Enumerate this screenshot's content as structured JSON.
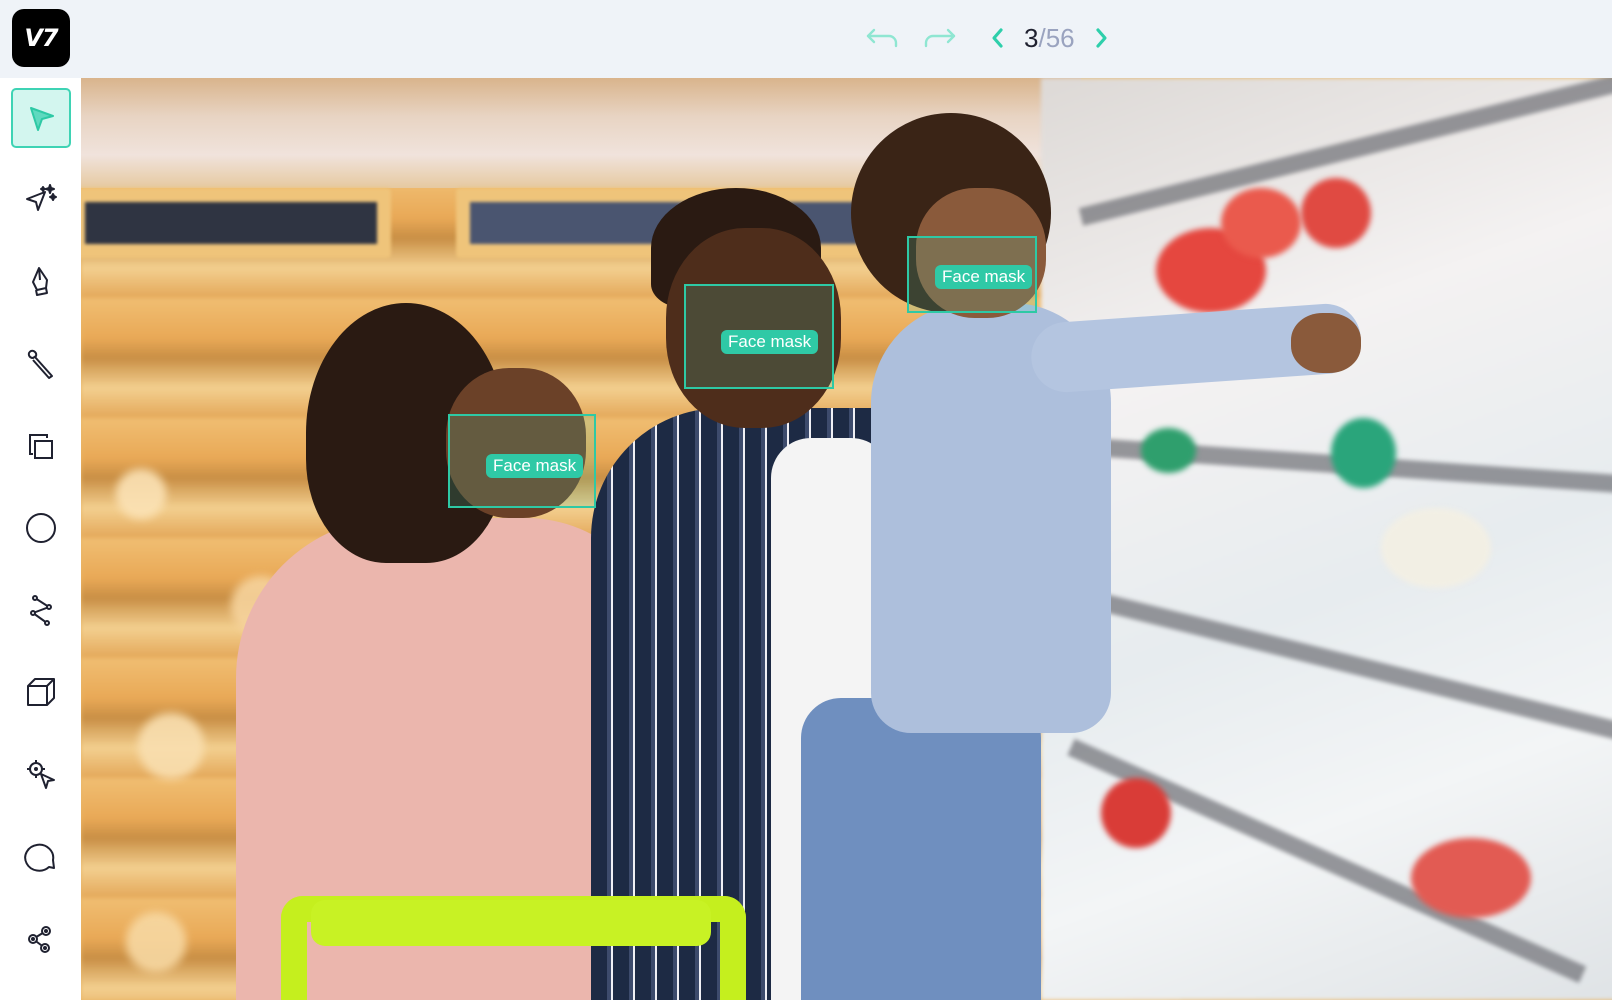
{
  "app": {
    "logo_text": "V7"
  },
  "toolbar": {
    "undo_icon": "undo-icon",
    "redo_icon": "redo-icon",
    "prev_icon": "chevron-left-icon",
    "next_icon": "chevron-right-icon",
    "current_page": "3",
    "separator": "/",
    "total_pages": "56",
    "accent_color": "#2ecfab",
    "disabled_color": "#8fe6d2"
  },
  "sidebar": {
    "tools": [
      {
        "name": "select",
        "icon": "cursor-arrow-icon",
        "active": true
      },
      {
        "name": "auto-annotate",
        "icon": "magic-cursor-sparkles-icon",
        "active": false
      },
      {
        "name": "polygon",
        "icon": "pen-nib-icon",
        "active": false
      },
      {
        "name": "brush",
        "icon": "paintbrush-icon",
        "active": false
      },
      {
        "name": "bounding-box",
        "icon": "overlapping-squares-icon",
        "active": false
      },
      {
        "name": "ellipse",
        "icon": "circle-icon",
        "active": false
      },
      {
        "name": "polyline",
        "icon": "polyline-icon",
        "active": false
      },
      {
        "name": "cuboid",
        "icon": "cube-icon",
        "active": false
      },
      {
        "name": "keypoint",
        "icon": "keypoint-cursor-icon",
        "active": false
      },
      {
        "name": "comment",
        "icon": "speech-bubble-icon",
        "active": false
      },
      {
        "name": "skeleton",
        "icon": "skeleton-nodes-icon",
        "active": false
      }
    ]
  },
  "canvas": {
    "image_description": "Family wearing face masks shopping in a supermarket",
    "annotations": [
      {
        "label": "Face mask",
        "class_color": "#2ec9a5"
      },
      {
        "label": "Face mask",
        "class_color": "#2ec9a5"
      },
      {
        "label": "Face mask",
        "class_color": "#2ec9a5"
      }
    ]
  }
}
